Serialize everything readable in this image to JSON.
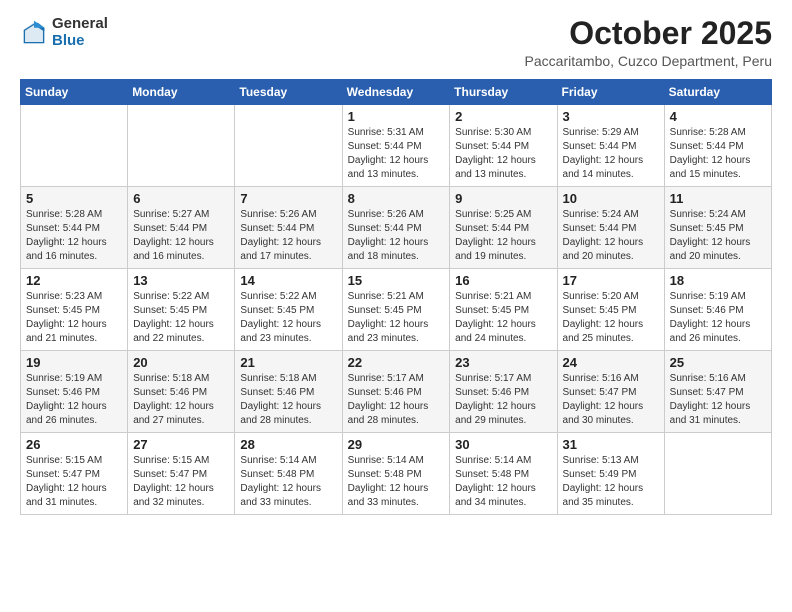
{
  "header": {
    "logo_general": "General",
    "logo_blue": "Blue",
    "month_title": "October 2025",
    "subtitle": "Paccaritambo, Cuzco Department, Peru"
  },
  "weekdays": [
    "Sunday",
    "Monday",
    "Tuesday",
    "Wednesday",
    "Thursday",
    "Friday",
    "Saturday"
  ],
  "weeks": [
    [
      {
        "day": "",
        "info": ""
      },
      {
        "day": "",
        "info": ""
      },
      {
        "day": "",
        "info": ""
      },
      {
        "day": "1",
        "info": "Sunrise: 5:31 AM\nSunset: 5:44 PM\nDaylight: 12 hours\nand 13 minutes."
      },
      {
        "day": "2",
        "info": "Sunrise: 5:30 AM\nSunset: 5:44 PM\nDaylight: 12 hours\nand 13 minutes."
      },
      {
        "day": "3",
        "info": "Sunrise: 5:29 AM\nSunset: 5:44 PM\nDaylight: 12 hours\nand 14 minutes."
      },
      {
        "day": "4",
        "info": "Sunrise: 5:28 AM\nSunset: 5:44 PM\nDaylight: 12 hours\nand 15 minutes."
      }
    ],
    [
      {
        "day": "5",
        "info": "Sunrise: 5:28 AM\nSunset: 5:44 PM\nDaylight: 12 hours\nand 16 minutes."
      },
      {
        "day": "6",
        "info": "Sunrise: 5:27 AM\nSunset: 5:44 PM\nDaylight: 12 hours\nand 16 minutes."
      },
      {
        "day": "7",
        "info": "Sunrise: 5:26 AM\nSunset: 5:44 PM\nDaylight: 12 hours\nand 17 minutes."
      },
      {
        "day": "8",
        "info": "Sunrise: 5:26 AM\nSunset: 5:44 PM\nDaylight: 12 hours\nand 18 minutes."
      },
      {
        "day": "9",
        "info": "Sunrise: 5:25 AM\nSunset: 5:44 PM\nDaylight: 12 hours\nand 19 minutes."
      },
      {
        "day": "10",
        "info": "Sunrise: 5:24 AM\nSunset: 5:44 PM\nDaylight: 12 hours\nand 20 minutes."
      },
      {
        "day": "11",
        "info": "Sunrise: 5:24 AM\nSunset: 5:45 PM\nDaylight: 12 hours\nand 20 minutes."
      }
    ],
    [
      {
        "day": "12",
        "info": "Sunrise: 5:23 AM\nSunset: 5:45 PM\nDaylight: 12 hours\nand 21 minutes."
      },
      {
        "day": "13",
        "info": "Sunrise: 5:22 AM\nSunset: 5:45 PM\nDaylight: 12 hours\nand 22 minutes."
      },
      {
        "day": "14",
        "info": "Sunrise: 5:22 AM\nSunset: 5:45 PM\nDaylight: 12 hours\nand 23 minutes."
      },
      {
        "day": "15",
        "info": "Sunrise: 5:21 AM\nSunset: 5:45 PM\nDaylight: 12 hours\nand 23 minutes."
      },
      {
        "day": "16",
        "info": "Sunrise: 5:21 AM\nSunset: 5:45 PM\nDaylight: 12 hours\nand 24 minutes."
      },
      {
        "day": "17",
        "info": "Sunrise: 5:20 AM\nSunset: 5:45 PM\nDaylight: 12 hours\nand 25 minutes."
      },
      {
        "day": "18",
        "info": "Sunrise: 5:19 AM\nSunset: 5:46 PM\nDaylight: 12 hours\nand 26 minutes."
      }
    ],
    [
      {
        "day": "19",
        "info": "Sunrise: 5:19 AM\nSunset: 5:46 PM\nDaylight: 12 hours\nand 26 minutes."
      },
      {
        "day": "20",
        "info": "Sunrise: 5:18 AM\nSunset: 5:46 PM\nDaylight: 12 hours\nand 27 minutes."
      },
      {
        "day": "21",
        "info": "Sunrise: 5:18 AM\nSunset: 5:46 PM\nDaylight: 12 hours\nand 28 minutes."
      },
      {
        "day": "22",
        "info": "Sunrise: 5:17 AM\nSunset: 5:46 PM\nDaylight: 12 hours\nand 28 minutes."
      },
      {
        "day": "23",
        "info": "Sunrise: 5:17 AM\nSunset: 5:46 PM\nDaylight: 12 hours\nand 29 minutes."
      },
      {
        "day": "24",
        "info": "Sunrise: 5:16 AM\nSunset: 5:47 PM\nDaylight: 12 hours\nand 30 minutes."
      },
      {
        "day": "25",
        "info": "Sunrise: 5:16 AM\nSunset: 5:47 PM\nDaylight: 12 hours\nand 31 minutes."
      }
    ],
    [
      {
        "day": "26",
        "info": "Sunrise: 5:15 AM\nSunset: 5:47 PM\nDaylight: 12 hours\nand 31 minutes."
      },
      {
        "day": "27",
        "info": "Sunrise: 5:15 AM\nSunset: 5:47 PM\nDaylight: 12 hours\nand 32 minutes."
      },
      {
        "day": "28",
        "info": "Sunrise: 5:14 AM\nSunset: 5:48 PM\nDaylight: 12 hours\nand 33 minutes."
      },
      {
        "day": "29",
        "info": "Sunrise: 5:14 AM\nSunset: 5:48 PM\nDaylight: 12 hours\nand 33 minutes."
      },
      {
        "day": "30",
        "info": "Sunrise: 5:14 AM\nSunset: 5:48 PM\nDaylight: 12 hours\nand 34 minutes."
      },
      {
        "day": "31",
        "info": "Sunrise: 5:13 AM\nSunset: 5:49 PM\nDaylight: 12 hours\nand 35 minutes."
      },
      {
        "day": "",
        "info": ""
      }
    ]
  ]
}
